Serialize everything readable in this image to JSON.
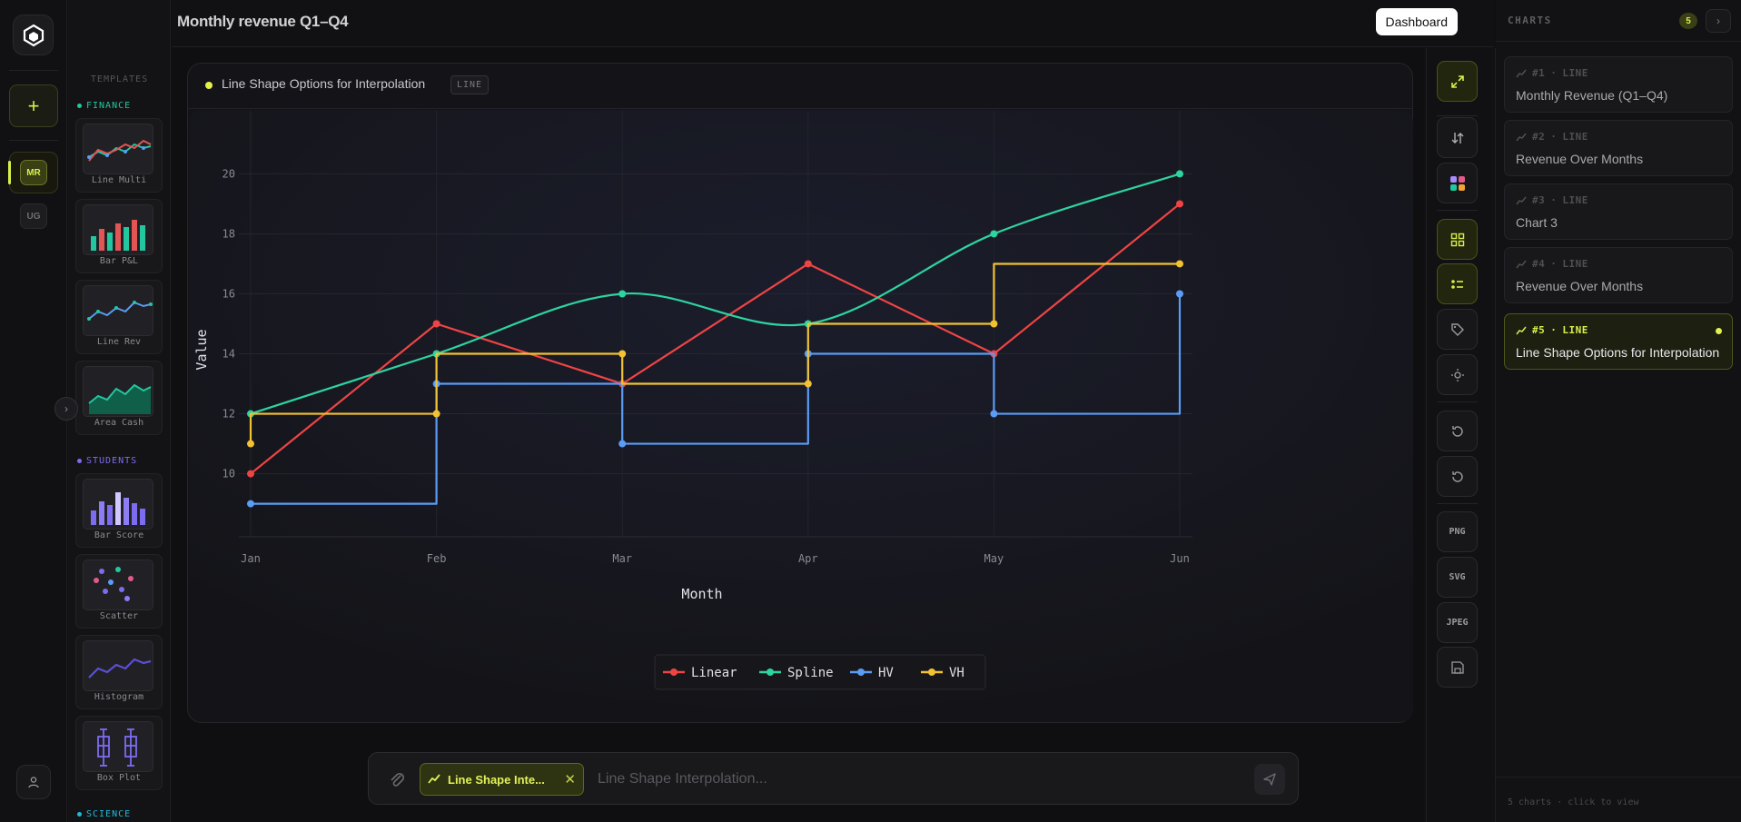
{
  "header": {
    "title": "Monthly revenue Q1–Q4",
    "dashboard_label": "Dashboard"
  },
  "rail": {
    "add_label": "+",
    "projects": [
      {
        "label": "MR",
        "active": true
      },
      {
        "label": "UG",
        "active": false
      }
    ]
  },
  "templates": {
    "heading": "TEMPLATES",
    "sections": [
      {
        "name": "FINANCE",
        "color": "#22c7a0",
        "items": [
          "Line Multi",
          "Bar P&L",
          "Line Rev",
          "Area Cash"
        ]
      },
      {
        "name": "STUDENTS",
        "color": "#7c6cf0",
        "items": [
          "Bar Score",
          "Scatter",
          "Histogram",
          "Box Plot"
        ]
      },
      {
        "name": "SCIENCE",
        "color": "#22b8d8",
        "items": []
      }
    ]
  },
  "card": {
    "title": "Line Shape Options for Interpolation",
    "badge": "LINE"
  },
  "chart_data": {
    "type": "line",
    "title": "Line Shape Options for Interpolation",
    "xlabel": "Month",
    "ylabel": "Value",
    "categories": [
      "Jan",
      "Feb",
      "Mar",
      "Apr",
      "May",
      "Jun"
    ],
    "ylim": [
      8.2,
      21.8
    ],
    "yticks": [
      10,
      12,
      14,
      16,
      18,
      20
    ],
    "grid": true,
    "legend_position": "bottom-center",
    "series": [
      {
        "name": "Linear",
        "color": "#ef4444",
        "shape": "linear",
        "values": [
          10,
          15,
          13,
          17,
          14,
          19
        ]
      },
      {
        "name": "Spline",
        "color": "#2dd4a0",
        "shape": "spline",
        "values": [
          12,
          14,
          16,
          15,
          18,
          20
        ]
      },
      {
        "name": "HV",
        "color": "#5b9cf5",
        "shape": "hv",
        "values": [
          9,
          13,
          11,
          14,
          12,
          16
        ]
      },
      {
        "name": "VH",
        "color": "#f2c232",
        "shape": "vh",
        "values": [
          11,
          12,
          14,
          13,
          15,
          17
        ]
      }
    ]
  },
  "toolbar": {
    "png": "PNG",
    "svg": "SVG",
    "jpeg": "JPEG",
    "icons": [
      "expand-icon",
      "swap-axes-icon",
      "palette-icon",
      "grid-icon",
      "legend-icon",
      "tag-icon",
      "theme-icon",
      "undo-icon",
      "redo-icon",
      "save-icon"
    ]
  },
  "charts_panel": {
    "title": "CHARTS",
    "count": "5",
    "items": [
      {
        "id": "#1",
        "type": "LINE",
        "name": "Monthly Revenue (Q1–Q4)",
        "active": false
      },
      {
        "id": "#2",
        "type": "LINE",
        "name": "Revenue Over Months",
        "active": false
      },
      {
        "id": "#3",
        "type": "LINE",
        "name": "Chart 3",
        "active": false
      },
      {
        "id": "#4",
        "type": "LINE",
        "name": "Revenue Over Months",
        "active": false
      },
      {
        "id": "#5",
        "type": "LINE",
        "name": "Line Shape Options for Interpolation",
        "active": true
      }
    ],
    "footer": "5 charts · click to view"
  },
  "input": {
    "chip_label": "Line Shape Inte...",
    "placeholder": "Line Shape Interpolation..."
  },
  "colors": {
    "accent": "#d8ef4a",
    "background": "#0f0f11"
  }
}
